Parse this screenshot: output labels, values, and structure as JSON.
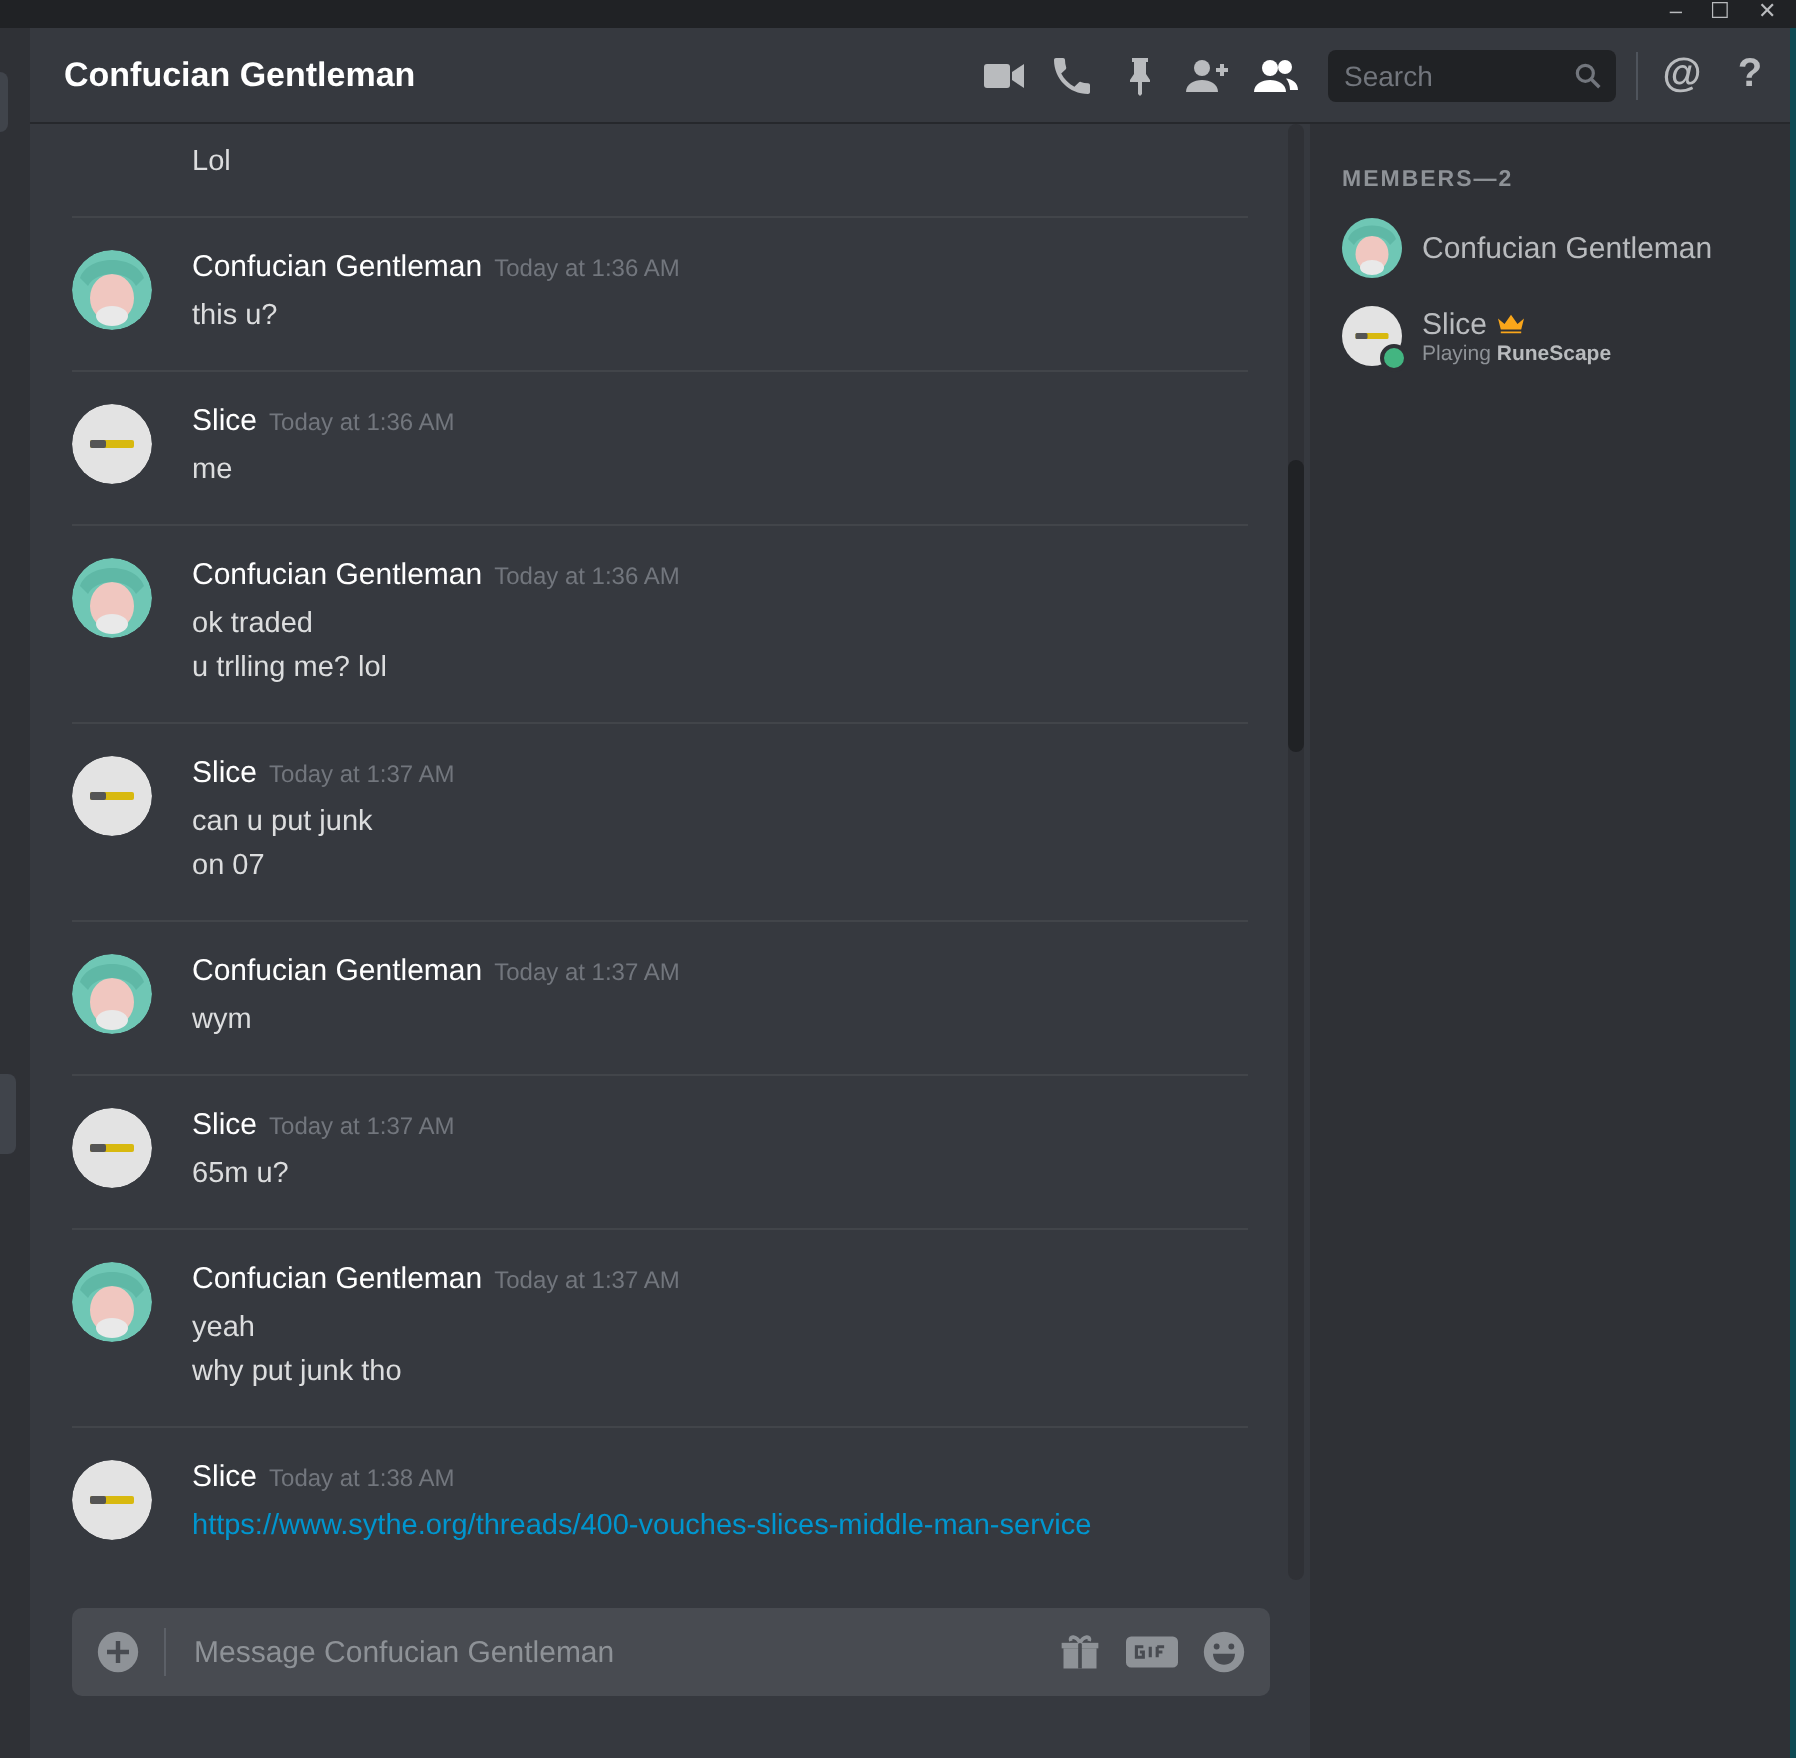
{
  "window": {
    "controls": [
      "–",
      "☐",
      "✕"
    ]
  },
  "channel": {
    "title": "Confucian Gentleman"
  },
  "toolbar": [
    {
      "kind": "video",
      "selected": false
    },
    {
      "kind": "call",
      "selected": false
    },
    {
      "kind": "pin",
      "selected": false
    },
    {
      "kind": "add-user",
      "selected": false
    },
    {
      "kind": "members",
      "selected": true
    }
  ],
  "search": {
    "placeholder": "Search"
  },
  "mentions": "@",
  "help": "?",
  "messages": [
    {
      "kind": "continuation",
      "lines": [
        "Lol"
      ]
    },
    {
      "kind": "teal",
      "author": "Confucian Gentleman",
      "time": "Today at 1:36 AM",
      "lines": [
        "this u?"
      ]
    },
    {
      "kind": "logo",
      "author": "Slice",
      "time": "Today at 1:36 AM",
      "lines": [
        "me"
      ]
    },
    {
      "kind": "teal",
      "author": "Confucian Gentleman",
      "time": "Today at 1:36 AM",
      "lines": [
        "ok traded",
        "u trlling me? lol"
      ]
    },
    {
      "kind": "logo",
      "author": "Slice",
      "time": "Today at 1:37 AM",
      "lines": [
        "can u put junk",
        "on 07"
      ]
    },
    {
      "kind": "teal",
      "author": "Confucian Gentleman",
      "time": "Today at 1:37 AM",
      "lines": [
        "wym"
      ]
    },
    {
      "kind": "logo",
      "author": "Slice",
      "time": "Today at 1:37 AM",
      "lines": [
        "65m u?"
      ]
    },
    {
      "kind": "teal",
      "author": "Confucian Gentleman",
      "time": "Today at 1:37 AM",
      "lines": [
        "yeah",
        "why put junk tho"
      ]
    },
    {
      "kind": "logo",
      "author": "Slice",
      "time": "Today at 1:38 AM",
      "link": "https://www.sythe.org/threads/400-vouches-slices-middle-man-service"
    }
  ],
  "composer": {
    "placeholder": "Message Confucian Gentleman"
  },
  "members": {
    "heading": "MEMBERS—2",
    "list": [
      {
        "name": "Confucian Gentleman",
        "kind": "teal",
        "owner": false,
        "online": false
      },
      {
        "name": "Slice",
        "kind": "logo",
        "owner": true,
        "online": true,
        "activity": "Playing",
        "game": "RuneScape"
      }
    ]
  }
}
